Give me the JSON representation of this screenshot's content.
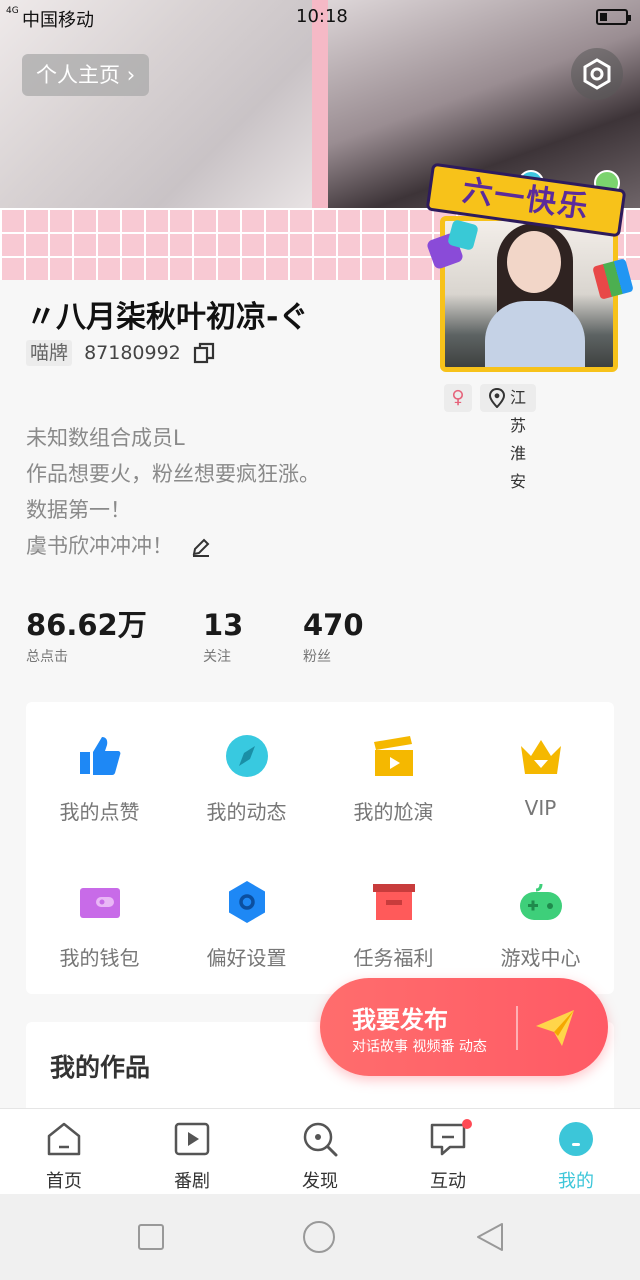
{
  "status_bar": {
    "signal": "4G",
    "carrier": "中国移动",
    "time": "10:18",
    "battery_level": 0.3
  },
  "header": {
    "home_button_label": "个人主页"
  },
  "avatar": {
    "festival_text": "六一快乐"
  },
  "profile": {
    "name": "〃八月柒秋叶初凉-ぐ",
    "id_badge": "喵牌",
    "id_value": "87180992",
    "gender_symbol": "♀",
    "location": "江苏 淮安",
    "bio": [
      "未知数组合成员L",
      "作品想要火，粉丝想要疯狂涨。",
      "数据第一！",
      "虞书欣冲冲冲！"
    ]
  },
  "stats": [
    {
      "value": "86.62万",
      "label": "总点击"
    },
    {
      "value": "13",
      "label": "关注"
    },
    {
      "value": "470",
      "label": "粉丝"
    }
  ],
  "menu": [
    {
      "label": "我的点赞",
      "icon": "thumbs-up-icon",
      "color": "#1e88f5"
    },
    {
      "label": "我的动态",
      "icon": "compass-icon",
      "color": "#38c9e0"
    },
    {
      "label": "我的尬演",
      "icon": "clapperboard-icon",
      "color": "#f5b800"
    },
    {
      "label": "VIP",
      "icon": "crown-icon",
      "color": "#f5b800"
    },
    {
      "label": "我的钱包",
      "icon": "wallet-icon",
      "color": "#c86be8"
    },
    {
      "label": "偏好设置",
      "icon": "hexagon-settings-icon",
      "color": "#1e88f5"
    },
    {
      "label": "任务福利",
      "icon": "archive-box-icon",
      "color": "#ff5a5a"
    },
    {
      "label": "游戏中心",
      "icon": "gamepad-icon",
      "color": "#3ecf7a"
    }
  ],
  "works": {
    "title": "我的作品"
  },
  "publish": {
    "title": "我要发布",
    "subtitle": "对话故事 视频番 动态"
  },
  "tabs": [
    {
      "label": "首页",
      "icon": "home-icon"
    },
    {
      "label": "番剧",
      "icon": "play-screen-icon"
    },
    {
      "label": "发现",
      "icon": "discover-search-icon"
    },
    {
      "label": "互动",
      "icon": "chat-icon"
    },
    {
      "label": "我的",
      "icon": "me-icon"
    }
  ],
  "colors": {
    "accent": "#3cc6d9",
    "publish": "#ff5a65",
    "notification_dot": "#ff4a55"
  }
}
